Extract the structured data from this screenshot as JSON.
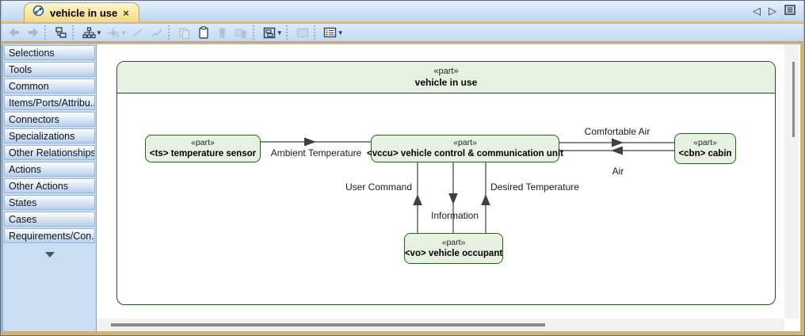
{
  "tab_bar": {
    "tab": {
      "label": "vehicle in use",
      "close": "×",
      "icon": "diagram-icon"
    },
    "nav": {
      "prev": "◁",
      "next": "▷",
      "list_icon": "tab-list-icon"
    }
  },
  "toolbar": {
    "icons": [
      {
        "name": "back-icon",
        "enabled": false
      },
      {
        "name": "forward-icon",
        "enabled": false
      },
      {
        "name": "containment-tree-icon",
        "enabled": true
      },
      {
        "name": "hierarchy-icon",
        "enabled": true,
        "dropdown": true
      },
      {
        "name": "align-icon",
        "enabled": false,
        "dropdown": true
      },
      {
        "name": "draw-line-icon",
        "enabled": false
      },
      {
        "name": "draw-polyline-icon",
        "enabled": false
      },
      {
        "name": "copy-icon",
        "enabled": false
      },
      {
        "name": "paste-icon",
        "enabled": true
      },
      {
        "name": "delete-icon",
        "enabled": false
      },
      {
        "name": "delete-with-contents-icon",
        "enabled": false
      },
      {
        "name": "window-layout-icon",
        "enabled": true,
        "dropdown": true
      },
      {
        "name": "image-icon",
        "enabled": false
      },
      {
        "name": "specification-icon",
        "enabled": true,
        "dropdown": true
      }
    ]
  },
  "sidebar": {
    "items": [
      {
        "label": "Selections"
      },
      {
        "label": "Tools"
      },
      {
        "label": "Common"
      },
      {
        "label": "Items/Ports/Attribu..."
      },
      {
        "label": "Connectors"
      },
      {
        "label": "Specializations"
      },
      {
        "label": "Other Relationships"
      },
      {
        "label": "Actions"
      },
      {
        "label": "Other Actions"
      },
      {
        "label": "States"
      },
      {
        "label": "Cases"
      },
      {
        "label": "Requirements/Con..."
      }
    ],
    "more_icon": "▼"
  },
  "diagram": {
    "frame": {
      "stereotype": "«part»",
      "name": "vehicle in use"
    },
    "blocks": [
      {
        "id": "ts",
        "stereotype": "«part»",
        "name": "<ts> temperature sensor"
      },
      {
        "id": "vccu",
        "stereotype": "«part»",
        "name": "<vccu> vehicle control & communication unit"
      },
      {
        "id": "cbn",
        "stereotype": "«part»",
        "name": "<cbn> cabin"
      },
      {
        "id": "vo",
        "stereotype": "«part»",
        "name": "<vo> vehicle occupant"
      }
    ],
    "connectors": [
      {
        "label": "Ambient Temperature",
        "from": "ts",
        "to": "vccu",
        "direction": "right"
      },
      {
        "label": "Comfortable Air",
        "from": "vccu",
        "to": "cbn",
        "direction": "right"
      },
      {
        "label": "Air",
        "from": "cbn",
        "to": "vccu",
        "direction": "left"
      },
      {
        "label": "User Command",
        "from": "vo",
        "to": "vccu",
        "direction": "up"
      },
      {
        "label": "Information",
        "from": "vccu",
        "to": "vo",
        "direction": "down"
      },
      {
        "label": "Desired Temperature",
        "from": "vo",
        "to": "vccu",
        "direction": "up"
      }
    ],
    "colors": {
      "block_fill": "#e7f1e2",
      "block_border": "#2f5b28",
      "frame_border": "#24511e",
      "connector": "#404040"
    }
  }
}
